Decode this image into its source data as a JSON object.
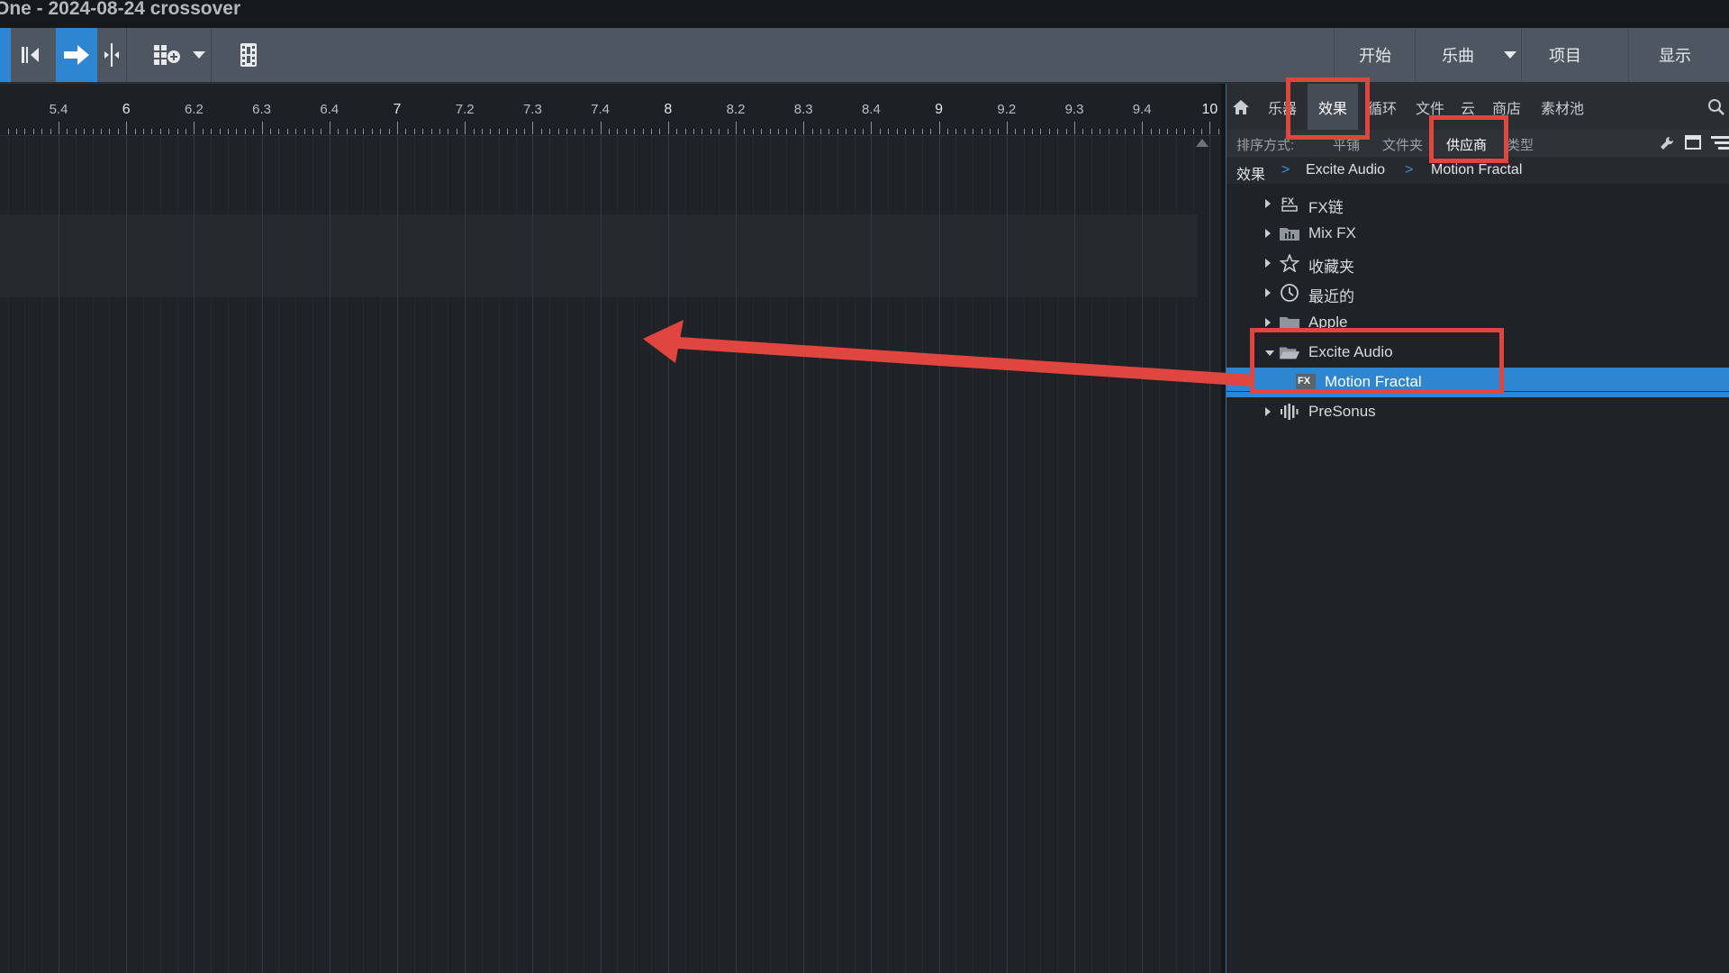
{
  "window": {
    "title": "One - 2024-08-24 crossover"
  },
  "toolbar": {
    "nav": {
      "start": "开始",
      "song": "乐曲",
      "project": "项目",
      "show": "显示"
    }
  },
  "ruler": {
    "labels": [
      {
        "t": "5.4",
        "major": false
      },
      {
        "t": "6",
        "major": true
      },
      {
        "t": "6.2",
        "major": false
      },
      {
        "t": "6.3",
        "major": false
      },
      {
        "t": "6.4",
        "major": false
      },
      {
        "t": "7",
        "major": true
      },
      {
        "t": "7.2",
        "major": false
      },
      {
        "t": "7.3",
        "major": false
      },
      {
        "t": "7.4",
        "major": false
      },
      {
        "t": "8",
        "major": true
      },
      {
        "t": "8.2",
        "major": false
      },
      {
        "t": "8.3",
        "major": false
      },
      {
        "t": "8.4",
        "major": false
      },
      {
        "t": "9",
        "major": true
      },
      {
        "t": "9.2",
        "major": false
      },
      {
        "t": "9.3",
        "major": false
      },
      {
        "t": "9.4",
        "major": false
      },
      {
        "t": "10",
        "major": true
      }
    ]
  },
  "browser": {
    "tabs": [
      "乐器",
      "效果",
      "循环",
      "文件",
      "云",
      "商店",
      "素材池"
    ],
    "active_tab": "效果",
    "sort": {
      "label": "排序方式:",
      "options": [
        "平铺",
        "文件夹",
        "供应商",
        "类型"
      ],
      "selected": "供应商"
    },
    "path": [
      "效果",
      "Excite Audio",
      "Motion Fractal"
    ],
    "tree": [
      {
        "label": "FX链",
        "icon": "fx-chain-icon",
        "state": "collapsed",
        "level": 0
      },
      {
        "label": "Mix FX",
        "icon": "mix-fx-icon",
        "state": "collapsed",
        "level": 0
      },
      {
        "label": "收藏夹",
        "icon": "star-icon",
        "state": "collapsed",
        "level": 0
      },
      {
        "label": "最近的",
        "icon": "clock-icon",
        "state": "collapsed",
        "level": 0
      },
      {
        "label": "Apple",
        "icon": "folder-icon",
        "state": "collapsed",
        "level": 0
      },
      {
        "label": "Excite Audio",
        "icon": "folder-open-icon",
        "state": "expanded",
        "level": 0
      },
      {
        "label": "Motion Fractal",
        "icon": "fx-plugin-icon",
        "state": "leaf",
        "level": 1,
        "selected": true
      },
      {
        "label": "PreSonus",
        "icon": "presonus-icon",
        "state": "collapsed",
        "level": 0
      }
    ]
  },
  "colors": {
    "accent": "#2e86d1",
    "annotation": "#e0463f"
  }
}
